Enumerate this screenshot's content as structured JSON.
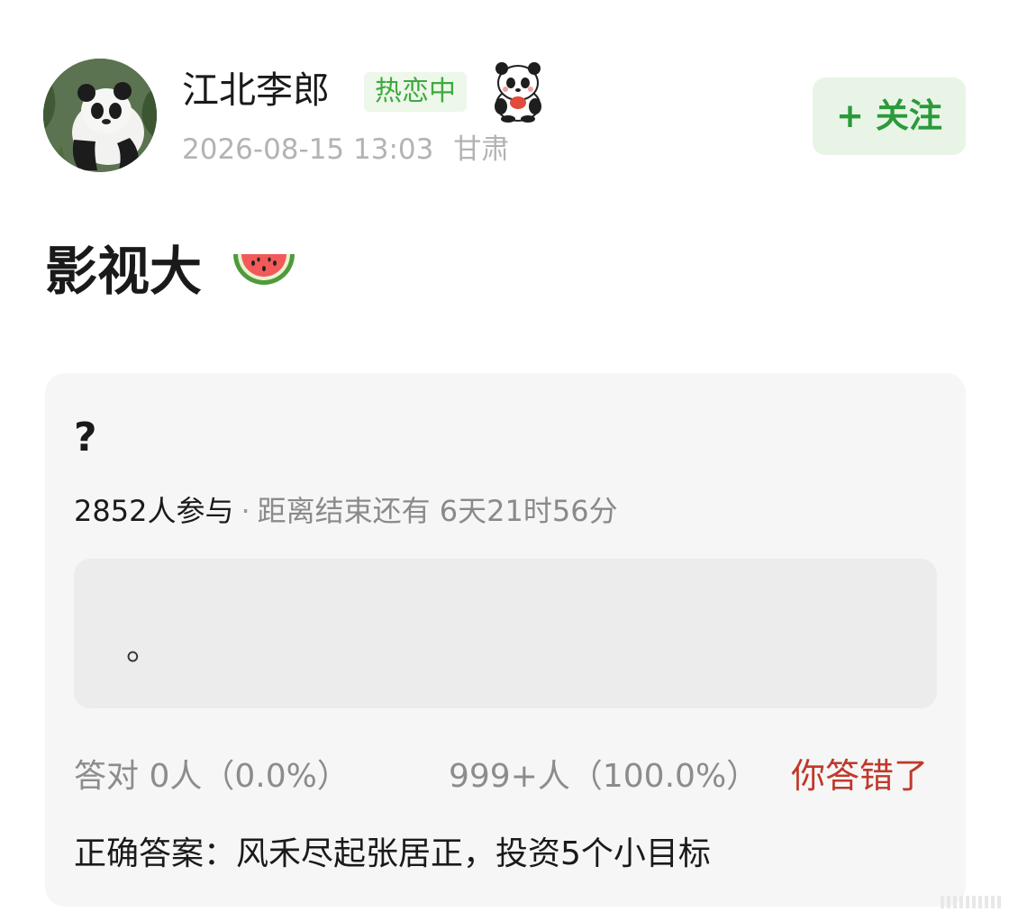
{
  "header": {
    "username": "江北李郎",
    "status_badge": "热恋中",
    "timestamp": "2026-08-15 13:03",
    "location": "甘肃",
    "follow_label": "+ 关注"
  },
  "post": {
    "title": "影视大"
  },
  "quiz": {
    "question": "?",
    "participants": "2852人参与",
    "separator": "·",
    "countdown": "距离结束还有 6天21时56分",
    "option_text": "。",
    "correct_result": "答对  0人（0.0%）",
    "wrong_result": "999+人（100.0%）",
    "verdict": "你答错了",
    "correct_answer": "正确答案：风禾尽起张居正，投资5个小目标"
  },
  "colors": {
    "accent_green": "#2a9a3a",
    "badge_green": "#3eaa3e",
    "wrong_red": "#c0392b",
    "card_bg": "#f6f6f6"
  },
  "icons": {
    "avatar": "panda-photo",
    "sticker": "panda-sticker-icon",
    "emoji": "watermelon-icon"
  }
}
